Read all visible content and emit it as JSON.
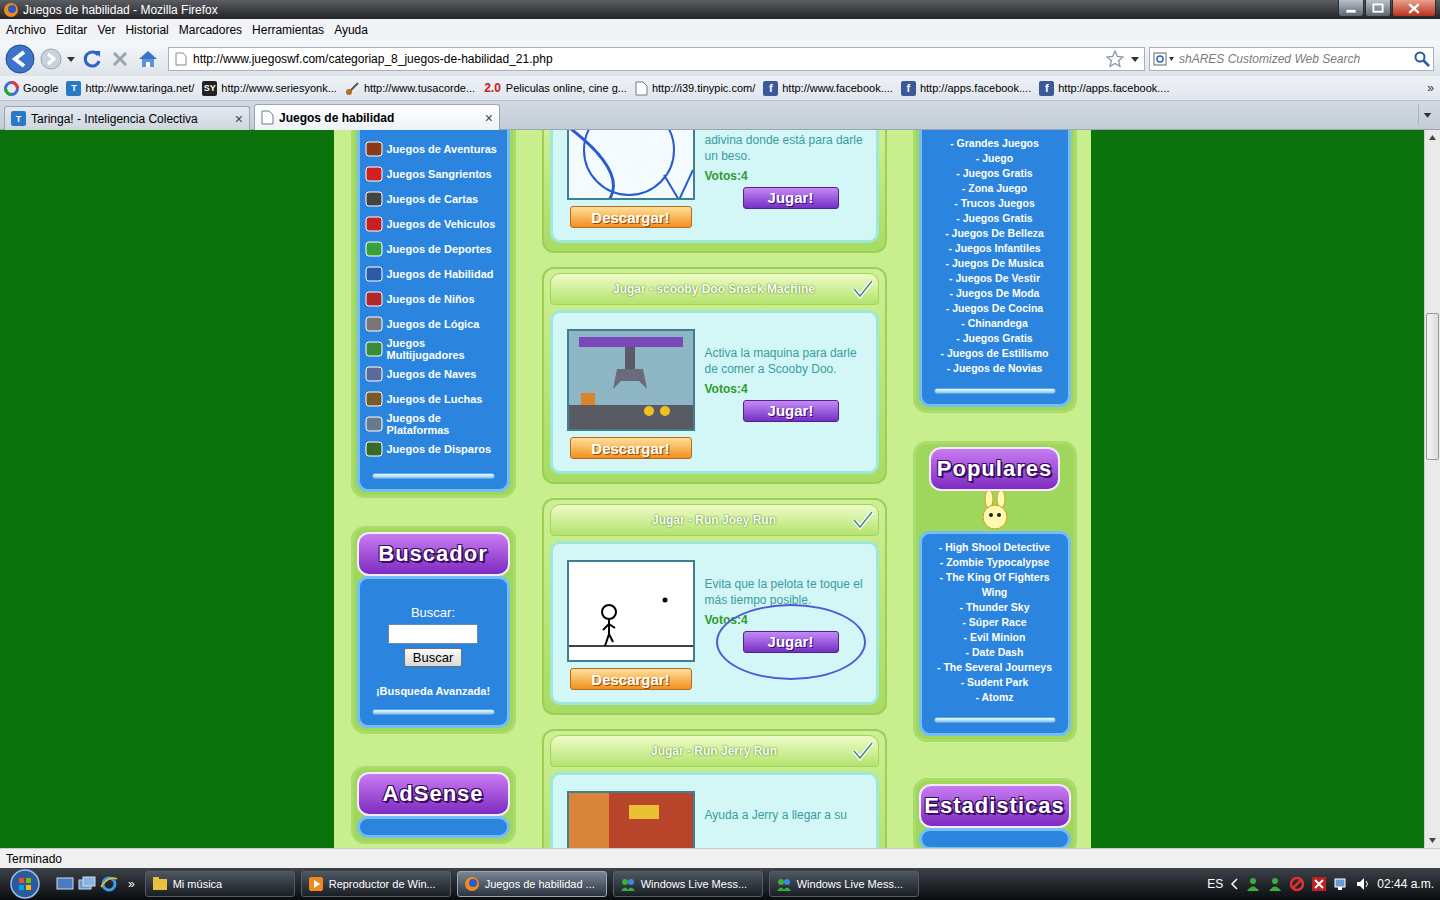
{
  "window": {
    "title": "Juegos de habilidad - Mozilla Firefox"
  },
  "menu": [
    "Archivo",
    "Editar",
    "Ver",
    "Historial",
    "Marcadores",
    "Herramientas",
    "Ayuda"
  ],
  "toolbar": {
    "url": "http://www.juegoswf.com/categoriap_8_juegos-de-habilidad_21.php",
    "search_placeholder": "shARES Customized Web Search"
  },
  "bookmarks": [
    {
      "label": "Google"
    },
    {
      "label": "http://www.taringa.net/",
      "icon": "T"
    },
    {
      "label": "http://www.seriesyonk...",
      "icon": "SY"
    },
    {
      "label": "http://www.tusacorde..."
    },
    {
      "label": "Peliculas online, cine g...",
      "icon": "2.0"
    },
    {
      "label": "http://i39.tinypic.com/"
    },
    {
      "label": "http://www.facebook....",
      "icon": "f"
    },
    {
      "label": "http://apps.facebook....",
      "icon": "f"
    },
    {
      "label": "http://apps.facebook....",
      "icon": "f"
    }
  ],
  "bookmarks_more": "»",
  "tabs": [
    {
      "label": "Taringa! - Inteligencia Colectiva",
      "icon": "T",
      "close": "×",
      "selected": false
    },
    {
      "label": "Juegos de habilidad",
      "close": "×",
      "selected": true
    }
  ],
  "page": {
    "categories": [
      "Juegos de Aventuras",
      "Juegos Sangrientos",
      "Juegos de Cartas",
      "Juegos de Vehiculos",
      "Juegos de Deportes",
      "Juegos de Habilidad",
      "Juegos de Niños",
      "Juegos de Lógica",
      "Juegos Multijugadores",
      "Juegos de Naves",
      "Juegos de Luchas",
      "Juegos de Plataformas",
      "Juegos de Disparos"
    ],
    "search_box": {
      "title": "Buscador",
      "label": "Buscar:",
      "button": "Buscar",
      "advanced": "¡Busqueda Avanzada!"
    },
    "adsense_title": "AdSense",
    "games": [
      {
        "description": "adivina donde está para darle un beso.",
        "votes": "Votos:4",
        "play": "Jugar!",
        "download": "Descargar!",
        "kind": "sketch",
        "annotated": false
      },
      {
        "title": "Jugar - scooby Doo Snack Machine",
        "description": "Activa la maquina para darle de comer a Scooby Doo.",
        "votes": "Votos:4",
        "play": "Jugar!",
        "download": "Descargar!",
        "kind": "machine",
        "annotated": false
      },
      {
        "title": "Jugar - Run Joey Run",
        "description": "Evita que la pelota te toque el más tiempo posible.",
        "votes": "Votos:4",
        "play": "Jugar!",
        "download": "Descargar!",
        "kind": "stickman",
        "annotated": true
      },
      {
        "title": "Jugar - Run Jerry Run",
        "description": "Ayuda a Jerry a llegar a su",
        "kind": "cartoon",
        "annotated": false
      }
    ],
    "links": [
      "- Grandes Juegos",
      "- Juego",
      "- Juegos Gratis",
      "- Zona Juego",
      "- Trucos Juegos",
      "- Juegos Gratis",
      "- Juegos De Belleza",
      "- Juegos Infantiles",
      "- Juegos De Musica",
      "- Juegos De Vestir",
      "- Juegos De Moda",
      "- Juegos De Cocina",
      "- Chinandega",
      "- Juegos Gratis",
      "- Juegos de Estilismo",
      "- Juegos de Novias"
    ],
    "popular_title": "Populares",
    "popular": [
      "- High Shool Detective",
      "- Zombie Typocalypse",
      "- The King Of Fighters Wing",
      "- Thunder Sky",
      "- Súper Race",
      "- Evil Minion",
      "- Date Dash",
      "- The Several Journeys",
      "- Sudent Park",
      "- Atomz"
    ],
    "stats_title": "Estadisticas"
  },
  "scrollbar": {
    "level": 0.31
  },
  "status_bar": "Terminado",
  "taskbar": {
    "more": "»",
    "items": [
      {
        "label": "Mi música",
        "selected": false
      },
      {
        "label": "Reproductor de Win...",
        "selected": false
      },
      {
        "label": "Juegos de habilidad ...",
        "selected": true
      },
      {
        "label": "Windows Live Mess...",
        "selected": false
      },
      {
        "label": "Windows Live Mess...",
        "selected": false
      }
    ],
    "language": "ES",
    "clock": "02:44 a.m."
  }
}
